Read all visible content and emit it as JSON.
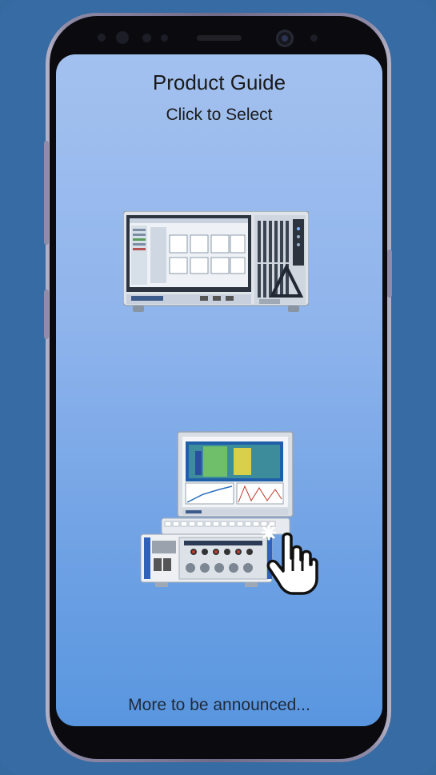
{
  "header": {
    "title": "Product Guide",
    "subtitle": "Click to Select"
  },
  "products": [
    {
      "name": "rack-mounted data acquisition system"
    },
    {
      "name": "portable data acquisition system with laptop screen"
    }
  ],
  "footer": {
    "text": "More to be announced..."
  },
  "colors": {
    "background": "#376ba3",
    "screen_top": "#a3c1ef",
    "screen_bottom": "#5996df"
  }
}
